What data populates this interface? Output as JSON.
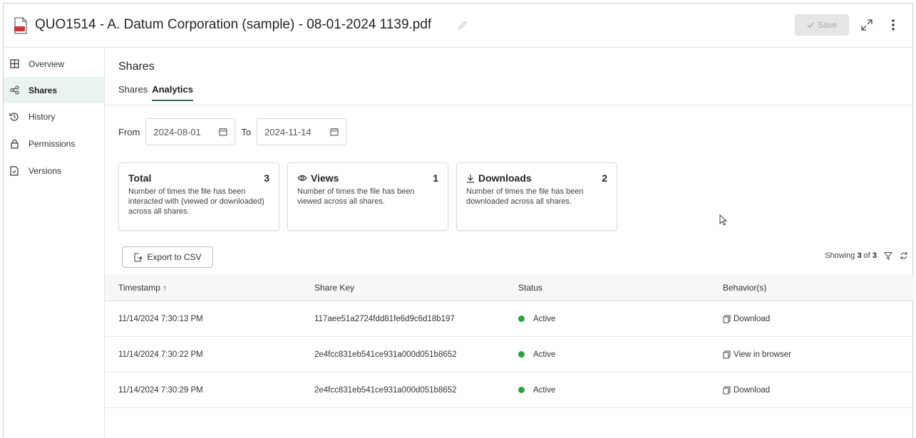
{
  "header": {
    "title": "QUO1514 - A. Datum Corporation (sample) - 08-01-2024 1139.pdf",
    "save_label": "Save",
    "icon": "pdf-file-icon"
  },
  "sidebar": {
    "items": [
      {
        "label": "Overview",
        "icon": "grid-icon"
      },
      {
        "label": "Shares",
        "icon": "share-icon",
        "active": true
      },
      {
        "label": "History",
        "icon": "history-icon"
      },
      {
        "label": "Permissions",
        "icon": "lock-icon"
      },
      {
        "label": "Versions",
        "icon": "versions-icon"
      }
    ]
  },
  "main": {
    "section_title": "Shares",
    "tabs": [
      {
        "label": "Shares"
      },
      {
        "label": "Analytics",
        "active": true
      }
    ],
    "dates": {
      "from_label": "From",
      "from_value": "2024-08-01",
      "to_label": "To",
      "to_value": "2024-11-14"
    },
    "cards": [
      {
        "title": "Total",
        "value": "3",
        "desc": "Number of times the file has been interacted with (viewed or downloaded) across all shares."
      },
      {
        "title": "Views",
        "value": "1",
        "desc": "Number of times the file has been viewed across all shares."
      },
      {
        "title": "Downloads",
        "value": "2",
        "desc": "Number of times the file has been downloaded across all shares."
      }
    ],
    "export_label": "Export to CSV",
    "showing": {
      "prefix": "Showing",
      "shown": "3",
      "of": "of",
      "total": "3"
    },
    "table": {
      "headers": [
        "Timestamp ↑",
        "Share Key",
        "Status",
        "Behavior(s)"
      ],
      "rows": [
        {
          "timestamp": "11/14/2024 7:30:13 PM",
          "key": "117aee51a2724fdd81fe6d9c6d18b197",
          "status": "Active",
          "behavior": "Download"
        },
        {
          "timestamp": "11/14/2024 7:30:22 PM",
          "key": "2e4fcc831eb541ce931a000d051b8652",
          "status": "Active",
          "behavior": "View in browser"
        },
        {
          "timestamp": "11/14/2024 7:30:29 PM",
          "key": "2e4fcc831eb541ce931a000d051b8652",
          "status": "Active",
          "behavior": "Download"
        }
      ]
    }
  },
  "colors": {
    "accent": "#2f6b5f",
    "active_bg": "#eaf3f1",
    "status_active": "#2ea043",
    "pdf_red": "#d13438"
  }
}
